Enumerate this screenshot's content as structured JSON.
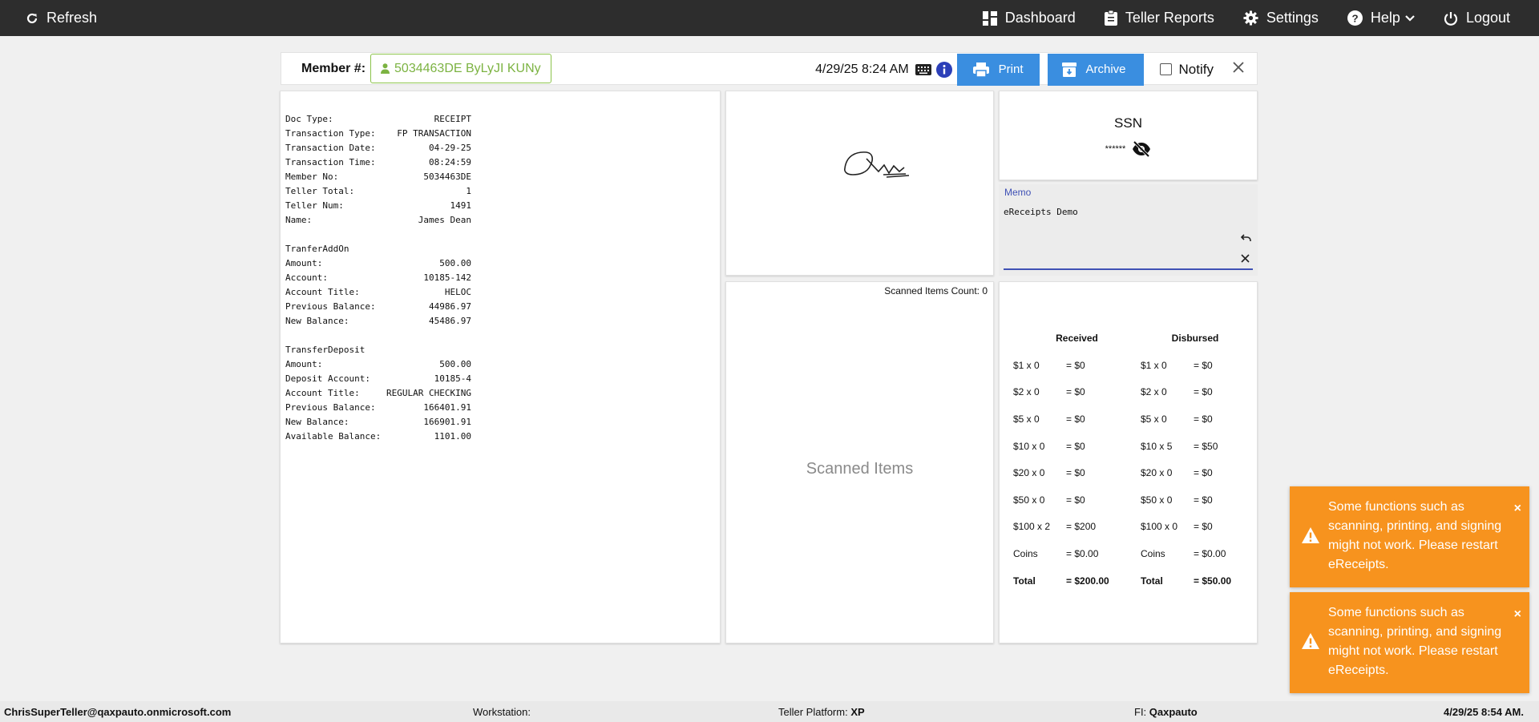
{
  "topbar": {
    "refresh": "Refresh",
    "nav": [
      {
        "label": "Dashboard"
      },
      {
        "label": "Teller Reports"
      },
      {
        "label": "Settings"
      },
      {
        "label": "Help"
      },
      {
        "label": "Logout"
      }
    ]
  },
  "member": {
    "label": "Member #:",
    "value": "5034463DE ByLyJI KUNy",
    "datetime": "4/29/25 8:24 AM",
    "print": "Print",
    "archive": "Archive",
    "notify": "Notify"
  },
  "receipt": {
    "lines": [
      {
        "l": "Doc Type:",
        "v": "RECEIPT"
      },
      {
        "l": "Transaction Type:",
        "v": "FP TRANSACTION"
      },
      {
        "l": "Transaction Date:",
        "v": "04-29-25"
      },
      {
        "l": "Transaction Time:",
        "v": "08:24:59"
      },
      {
        "l": "Member No:",
        "v": "5034463DE"
      },
      {
        "l": "Teller Total:",
        "v": "1"
      },
      {
        "l": "Teller Num:",
        "v": "1491"
      },
      {
        "l": "Name:",
        "v": "James Dean"
      },
      {
        "l": "",
        "v": ""
      },
      {
        "l": "TranferAddOn",
        "v": ""
      },
      {
        "l": "Amount:",
        "v": "500.00"
      },
      {
        "l": "Account:",
        "v": "10185-142"
      },
      {
        "l": "Account Title:",
        "v": "HELOC"
      },
      {
        "l": "Previous Balance:",
        "v": "44986.97"
      },
      {
        "l": "New Balance:",
        "v": "45486.97"
      },
      {
        "l": "",
        "v": ""
      },
      {
        "l": "TransferDeposit",
        "v": ""
      },
      {
        "l": "Amount:",
        "v": "500.00"
      },
      {
        "l": "Deposit Account:",
        "v": "10185-4"
      },
      {
        "l": "Account Title:",
        "v": "REGULAR CHECKING"
      },
      {
        "l": "Previous Balance:",
        "v": "166401.91"
      },
      {
        "l": "New Balance:",
        "v": "166901.91"
      },
      {
        "l": "Available Balance:",
        "v": "1101.00"
      }
    ]
  },
  "scan": {
    "count_label": "Scanned Items Count: 0",
    "title": "Scanned Items"
  },
  "ssn": {
    "title": "SSN",
    "masked": "******"
  },
  "memo": {
    "label": "Memo",
    "text": "eReceipts Demo"
  },
  "cash": {
    "received_header": "Received",
    "disbursed_header": "Disbursed",
    "rows": [
      {
        "r_qty": "$1 x 0",
        "r_amt": "= $0",
        "d_qty": "$1 x 0",
        "d_amt": "= $0"
      },
      {
        "r_qty": "$2 x 0",
        "r_amt": "= $0",
        "d_qty": "$2 x 0",
        "d_amt": "= $0"
      },
      {
        "r_qty": "$5 x 0",
        "r_amt": "= $0",
        "d_qty": "$5 x 0",
        "d_amt": "= $0"
      },
      {
        "r_qty": "$10 x 0",
        "r_amt": "= $0",
        "d_qty": "$10 x 5",
        "d_amt": "= $50"
      },
      {
        "r_qty": "$20 x 0",
        "r_amt": "= $0",
        "d_qty": "$20 x 0",
        "d_amt": "= $0"
      },
      {
        "r_qty": "$50 x 0",
        "r_amt": "= $0",
        "d_qty": "$50 x 0",
        "d_amt": "= $0"
      },
      {
        "r_qty": "$100 x 2",
        "r_amt": "= $200",
        "d_qty": "$100 x 0",
        "d_amt": "= $0"
      },
      {
        "r_qty": "Coins",
        "r_amt": "= $0.00",
        "d_qty": "Coins",
        "d_amt": "= $0.00"
      },
      {
        "r_qty": "Total",
        "r_amt": "= $200.00",
        "d_qty": "Total",
        "d_amt": "= $50.00"
      }
    ]
  },
  "toasts": [
    {
      "message": "Some functions such as scanning, printing, and signing might not work. Please restart eReceipts.",
      "close": "×"
    },
    {
      "message": "Some functions such as scanning, printing, and signing might not work. Please restart eReceipts.",
      "close": "×"
    }
  ],
  "footer": {
    "user": "ChrisSuperTeller@qaxpauto.onmicrosoft.com",
    "workstation_label": "Workstation:",
    "platform_label": "Teller Platform:",
    "platform_value": "XP",
    "fi_label": "FI:",
    "fi_value": "Qaxpauto",
    "datetime": "4/29/25 8:54 AM."
  },
  "colors": {
    "topbar": "#2d2d2d",
    "button_blue": "#3a8ee0",
    "member_green": "#7cb342",
    "toast_orange": "#f7931e",
    "memo_accent": "#3f51b5"
  }
}
